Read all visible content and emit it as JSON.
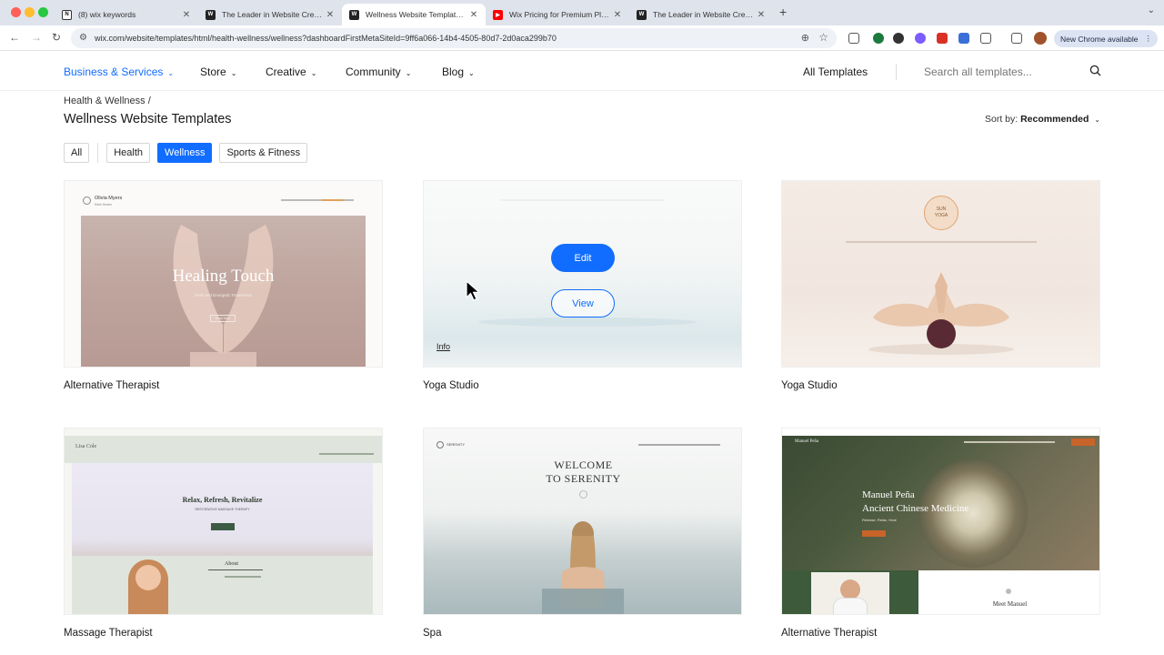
{
  "browser": {
    "tabs": [
      {
        "title": "(8) wix keywords",
        "favicon": "notion-icon",
        "active": false
      },
      {
        "title": "The Leader in Website Creation",
        "favicon": "wix-icon",
        "active": false
      },
      {
        "title": "Wellness Website Templates | Wix",
        "favicon": "wix-icon",
        "active": true
      },
      {
        "title": "Wix Pricing for Premium Plans",
        "favicon": "youtube-icon",
        "active": false
      },
      {
        "title": "The Leader in Website Creation",
        "favicon": "wix-icon",
        "active": false
      }
    ],
    "url": "wix.com/website/templates/html/health-wellness/wellness?dashboardFirstMetaSiteId=9ff6a066-14b4-4505-80d7-2d0aca299b70",
    "new_chrome_label": "New Chrome available"
  },
  "nav": {
    "items": [
      {
        "label": "Business & Services",
        "active": true
      },
      {
        "label": "Store",
        "active": false
      },
      {
        "label": "Creative",
        "active": false
      },
      {
        "label": "Community",
        "active": false
      },
      {
        "label": "Blog",
        "active": false
      }
    ],
    "all_templates": "All Templates",
    "search_placeholder": "Search all templates..."
  },
  "page": {
    "breadcrumb": "Health & Wellness /",
    "title": "Wellness Website Templates",
    "sort_label": "Sort by:",
    "sort_value": "Recommended",
    "filters": [
      "All",
      "Health",
      "Wellness",
      "Sports & Fitness"
    ],
    "active_filter": "Wellness"
  },
  "templates": [
    {
      "name": "Alternative Therapist",
      "preview_brand": "Olivia Myers",
      "preview_tagline": "Reiki Healer",
      "preview_headline": "Healing Touch",
      "preview_sub": "Reiki and Energetic Treatments",
      "preview_button": "Book Now"
    },
    {
      "name": "Yoga Studio",
      "hovered": true,
      "edit_label": "Edit",
      "view_label": "View",
      "info_label": "Info"
    },
    {
      "name": "Yoga Studio",
      "preview_logo_line1": "SUN",
      "preview_logo_line2": "YOGA"
    },
    {
      "name": "Massage Therapist",
      "preview_brand": "Lisa Cole",
      "preview_headline": "Relax, Refresh, Revitalize",
      "preview_sub": "RESTORATIVE MASSAGE THERAPY",
      "preview_about": "About"
    },
    {
      "name": "Spa",
      "preview_brand": "SERENITY",
      "preview_headline_line1": "WELCOME",
      "preview_headline_line2": "TO SERENITY"
    },
    {
      "name": "Alternative Therapist",
      "preview_brand": "Manuel Peña",
      "preview_headline_line1": "Manuel Peña",
      "preview_headline_line2": "Ancient Chinese Medicine",
      "preview_sub": "Release, Relax, Heal",
      "preview_meet": "Meet Manuel"
    }
  ],
  "colors": {
    "wix_blue": "#116dff"
  }
}
